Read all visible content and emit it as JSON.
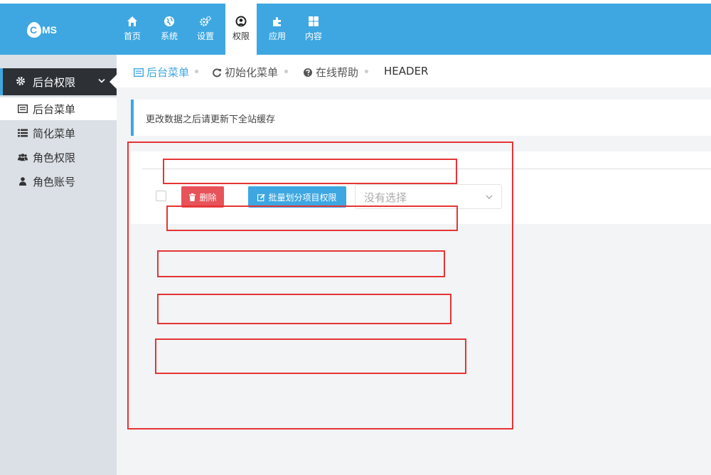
{
  "topbar": {
    "logo_text": "MS",
    "nav": [
      {
        "label": "首页",
        "icon": "home-icon"
      },
      {
        "label": "系统",
        "icon": "globe-icon"
      },
      {
        "label": "设置",
        "icon": "cogs-icon"
      },
      {
        "label": "权限",
        "icon": "user-circle-icon",
        "active": true
      },
      {
        "label": "应用",
        "icon": "puzzle-icon"
      },
      {
        "label": "内容",
        "icon": "grid-icon"
      }
    ]
  },
  "sidebar": {
    "group_label": "后台权限",
    "items": [
      {
        "label": "后台菜单",
        "icon": "list-alt-icon",
        "active": true
      },
      {
        "label": "简化菜单",
        "icon": "list-icon"
      },
      {
        "label": "角色权限",
        "icon": "users-icon"
      },
      {
        "label": "角色账号",
        "icon": "user-icon"
      }
    ]
  },
  "breadcrumb": {
    "items": [
      "后台菜单",
      "初始化菜单",
      "在线帮助",
      "HEADER"
    ]
  },
  "notice": "更改数据之后请更新下全站缓存",
  "toolbar": {
    "delete_label": "删除",
    "batch_label": "批量划分项目权限",
    "select_placeholder": "没有选择"
  },
  "colors": {
    "primary": "#3ea7e1",
    "danger": "#e8535a",
    "sidebar_bg": "#dbe0e6",
    "sidebar_group_bg": "#2d3136",
    "annotation_red": "#e63434"
  }
}
